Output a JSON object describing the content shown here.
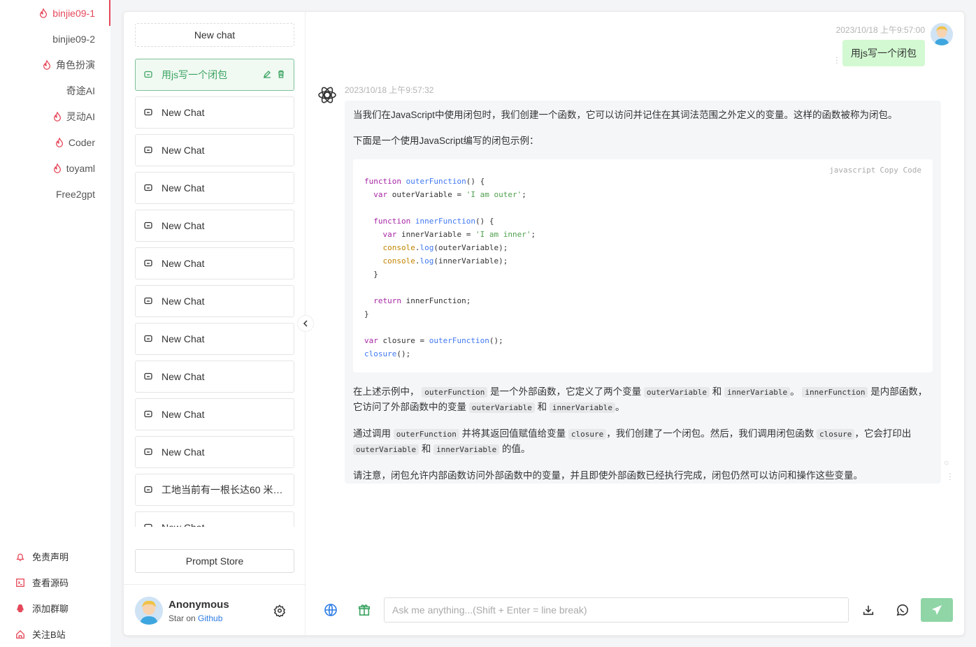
{
  "left_nav": {
    "items": [
      {
        "label": "binjie09-1",
        "icon": "fire-icon",
        "active": true
      },
      {
        "label": "binjie09-2",
        "icon": "",
        "active": false
      },
      {
        "label": "角色扮演",
        "icon": "fire-icon",
        "active": false
      },
      {
        "label": "奇途AI",
        "icon": "",
        "active": false
      },
      {
        "label": "灵动AI",
        "icon": "fire-icon",
        "active": false
      },
      {
        "label": "Coder",
        "icon": "fire-icon",
        "active": false
      },
      {
        "label": "toyaml",
        "icon": "fire-icon",
        "active": false
      },
      {
        "label": "Free2gpt",
        "icon": "",
        "active": false
      }
    ],
    "bottom_links": [
      {
        "label": "免责声明",
        "icon": "bell-icon"
      },
      {
        "label": "查看源码",
        "icon": "terminal-icon"
      },
      {
        "label": "添加群聊",
        "icon": "qq-icon"
      },
      {
        "label": "关注B站",
        "icon": "home-icon"
      }
    ],
    "accent_color": "#e5485a"
  },
  "sidebar": {
    "new_chat_label": "New chat",
    "chats": [
      {
        "title": "用js写一个闭包",
        "active": true
      },
      {
        "title": "New Chat"
      },
      {
        "title": "New Chat"
      },
      {
        "title": "New Chat"
      },
      {
        "title": "New Chat"
      },
      {
        "title": "New Chat"
      },
      {
        "title": "New Chat"
      },
      {
        "title": "New Chat"
      },
      {
        "title": "New Chat"
      },
      {
        "title": "New Chat"
      },
      {
        "title": "New Chat"
      },
      {
        "title": "工地当前有一根长达60 米的钢管"
      },
      {
        "title": "New Chat"
      }
    ],
    "prompt_store_label": "Prompt Store",
    "user": {
      "name": "Anonymous",
      "star_prefix": "Star on",
      "star_link": "Github"
    }
  },
  "conversation": {
    "user_message": {
      "time": "2023/10/18 上午9:57:00",
      "text": "用js写一个闭包"
    },
    "assistant_message": {
      "time": "2023/10/18 上午9:57:32",
      "intro1": "当我们在JavaScript中使用闭包时，我们创建一个函数，它可以访问并记住在其词法范围之外定义的变量。这样的函数被称为闭包。",
      "intro2": "下面是一个使用JavaScript编写的闭包示例：",
      "code_lang": "javascript",
      "copy_label": "Copy Code",
      "p1_a": "在上述示例中，",
      "p1_c1": "outerFunction",
      "p1_b": "是一个外部函数，它定义了两个变量",
      "p1_c2": "outerVariable",
      "p1_and1": "和",
      "p1_c3": "innerVariable",
      "p1_d": "。",
      "p1_c4": "innerFunction",
      "p1_e": "是内部函数，它访问了外部函数中的变量",
      "p1_c5": "outerVariable",
      "p1_and2": "和",
      "p1_c6": "innerVariable",
      "p1_f": "。",
      "p2_a": "通过调用",
      "p2_c1": "outerFunction",
      "p2_b": "并将其返回值赋值给变量",
      "p2_c2": "closure",
      "p2_c": "，我们创建了一个闭包。然后，我们调用闭包函数",
      "p2_c3": "closure",
      "p2_d": "，它会打印出",
      "p2_c4": "outerVariable",
      "p2_and": "和",
      "p2_c5": "innerVariable",
      "p2_e": "的值。",
      "p3": "请注意，闭包允许内部函数访问外部函数中的变量，并且即使外部函数已经执行完成，闭包仍然可以访问和操作这些变量。"
    }
  },
  "input": {
    "placeholder": "Ask me anything...(Shift + Enter = line break)",
    "value": ""
  },
  "colors": {
    "user_bubble": "#d2f9d1",
    "active_chat": "#3aa461",
    "send_button": "#8fd5a6"
  }
}
